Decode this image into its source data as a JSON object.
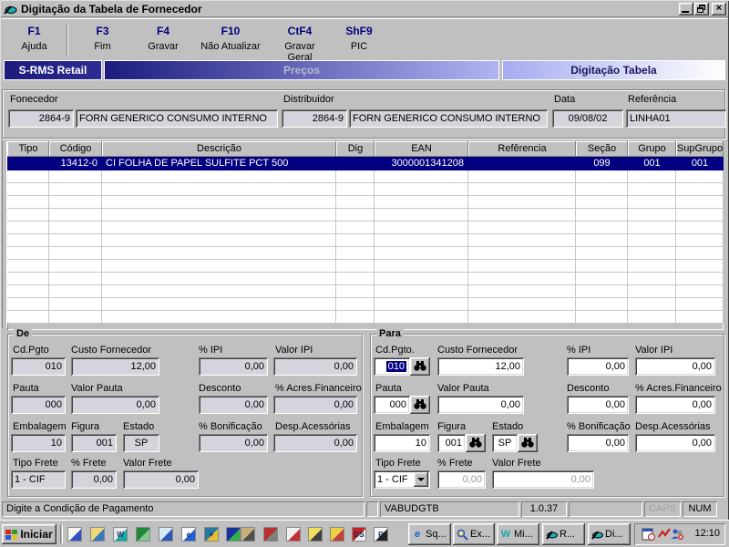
{
  "window": {
    "title": "Digitação da Tabela de Fornecedor",
    "close_glyph": "×"
  },
  "toolbar": {
    "items": [
      {
        "key": "F1",
        "label": "Ajuda"
      },
      {
        "key": "F3",
        "label": "Fim"
      },
      {
        "key": "F4",
        "label": "Gravar"
      },
      {
        "key": "F10",
        "label": "Não Atualizar"
      },
      {
        "key": "CtF4",
        "label": "Gravar Geral"
      },
      {
        "key": "ShF9",
        "label": "PIC"
      }
    ]
  },
  "tabs": [
    {
      "label": "S-RMS Retail"
    },
    {
      "label": "Preços"
    },
    {
      "label": "Digitação Tabela"
    }
  ],
  "header_fields": {
    "fornecedor_label": "Fonecedor",
    "fornecedor_code": "2864-9",
    "fornecedor_name": "FORN GENERICO CONSUMO INTERNO",
    "distribuidor_label": "Distribuidor",
    "distribuidor_code": "2864-9",
    "distribuidor_name": "FORN GENERICO CONSUMO INTERNO",
    "data_label": "Data",
    "data_value": "09/08/02",
    "referencia_label": "Referência",
    "referencia_value": "LINHA01"
  },
  "grid": {
    "columns": [
      "Tipo",
      "Código",
      "Descrição",
      "Dig",
      "EAN",
      "Refêrencia",
      "Seção",
      "Grupo",
      "SupGrupo"
    ],
    "rows": [
      {
        "tipo": "",
        "codigo": "13412-0",
        "descricao": "CI FOLHA DE PAPEL SULFITE PCT 500",
        "dig": "",
        "ean": "3000001341208",
        "referencia": "",
        "secao": "099",
        "grupo": "001",
        "supgrupo": "001"
      }
    ],
    "empty_row_count": 12
  },
  "de": {
    "title": "De",
    "fields": {
      "cd_pgto": {
        "label": "Cd.Pgto",
        "value": "010"
      },
      "custo": {
        "label": "Custo Fornecedor",
        "value": "12,00"
      },
      "ipi": {
        "label": "% IPI",
        "value": "0,00"
      },
      "valor_ipi": {
        "label": "Valor IPI",
        "value": "0,00"
      },
      "pauta": {
        "label": "Pauta",
        "value": "000"
      },
      "valor_pauta": {
        "label": "Valor Pauta",
        "value": "0,00"
      },
      "desconto": {
        "label": "Desconto",
        "value": "0,00"
      },
      "acres": {
        "label": "% Acres.Financeiro",
        "value": "0,00"
      },
      "embalagem": {
        "label": "Embalagem",
        "value": "10"
      },
      "figura": {
        "label": "Figura",
        "value": "001"
      },
      "estado": {
        "label": "Estado",
        "value": "SP"
      },
      "bonificacao": {
        "label": "% Bonificação",
        "value": "0,00"
      },
      "desp": {
        "label": "Desp.Acessórias",
        "value": "0,00"
      },
      "tipo_frete": {
        "label": "Tipo Frete",
        "value": "1 - CIF"
      },
      "frete": {
        "label": "% Frete",
        "value": "0,00"
      },
      "valor_frete": {
        "label": "Valor Frete",
        "value": "0,00"
      }
    }
  },
  "para": {
    "title": "Para",
    "fields": {
      "cd_pgto": {
        "label": "Cd.Pgto.",
        "value": "010"
      },
      "custo": {
        "label": "Custo Fornecedor",
        "value": "12,00"
      },
      "ipi": {
        "label": "% IPI",
        "value": "0,00"
      },
      "valor_ipi": {
        "label": "Valor IPI",
        "value": "0,00"
      },
      "pauta": {
        "label": "Pauta",
        "value": "000"
      },
      "valor_pauta": {
        "label": "Valor Pauta",
        "value": "0,00"
      },
      "desconto": {
        "label": "Desconto",
        "value": "0,00"
      },
      "acres": {
        "label": "% Acres.Financeiro",
        "value": "0,00"
      },
      "embalagem": {
        "label": "Embalagem",
        "value": "10"
      },
      "figura": {
        "label": "Figura",
        "value": "001"
      },
      "estado": {
        "label": "Estado",
        "value": "SP"
      },
      "bonificacao": {
        "label": "% Bonificação",
        "value": "0,00"
      },
      "desp": {
        "label": "Desp.Acessórias",
        "value": "0,00"
      },
      "tipo_frete": {
        "label": "Tipo Frete",
        "value": "1 - CIF"
      },
      "frete": {
        "label": "% Frete",
        "value": "0,00"
      },
      "valor_frete": {
        "label": "Valor Frete",
        "value": "0,00"
      }
    }
  },
  "statusbar": {
    "message": "Digite a Condição de Pagamento",
    "program": "VABUDGTB",
    "version": "1.0.37",
    "caps": "CAPS",
    "num": "NUM"
  },
  "taskbar": {
    "start_label": "Iniciar",
    "quicklaunch": [
      {
        "name": "desktop-edit-icon",
        "c1": "#f6f6ee",
        "c2": "#3050c8",
        "letter": ""
      },
      {
        "name": "viewer-search-icon",
        "c1": "#f0d878",
        "c2": "#3878c0",
        "letter": ""
      },
      {
        "name": "word-icon",
        "c1": "#e8e8e8",
        "c2": "#10a8a8",
        "letter": "W"
      },
      {
        "name": "green-app-icon",
        "c1": "#208838",
        "c2": "#80c890",
        "letter": ""
      },
      {
        "name": "mail-sync-icon",
        "c1": "#d8e8f8",
        "c2": "#2858b8",
        "letter": ""
      },
      {
        "name": "internet-explorer-icon",
        "c1": "#ffffff",
        "c2": "#2060d8",
        "letter": "e"
      },
      {
        "name": "plus-tool-icon",
        "c1": "#2878a0",
        "c2": "#e8c030",
        "letter": "+"
      },
      {
        "name": "shapes-grid-icon",
        "c1": "#1830a0",
        "c2": "#30b048",
        "letter": ""
      },
      {
        "name": "computer-icon",
        "c1": "#c8b078",
        "c2": "#505050",
        "letter": ""
      },
      {
        "name": "train-icon",
        "c1": "#b83030",
        "c2": "#808080",
        "letter": ""
      },
      {
        "name": "media-circle-icon",
        "c1": "#f0f0f0",
        "c2": "#c03030",
        "letter": ""
      },
      {
        "name": "notes-pencil-icon",
        "c1": "#f0e060",
        "c2": "#404040",
        "letter": ""
      },
      {
        "name": "paint-kite-icon",
        "c1": "#e8d040",
        "c2": "#c04040",
        "letter": ""
      },
      {
        "name": "kds-icon",
        "c1": "#c82020",
        "c2": "#f0f0f0",
        "letter": "DS"
      },
      {
        "name": "rms-icon",
        "c1": "#f8f8f8",
        "c2": "#202020",
        "letter": "R"
      }
    ],
    "buttons": [
      {
        "label": "Sq...",
        "icon": "ie"
      },
      {
        "label": "Ex...",
        "icon": "magnifier"
      },
      {
        "label": "Mi...",
        "icon": "word"
      },
      {
        "label": "R...",
        "icon": "app1"
      },
      {
        "label": "Di...",
        "icon": "app2"
      }
    ],
    "clock": "12:10"
  }
}
